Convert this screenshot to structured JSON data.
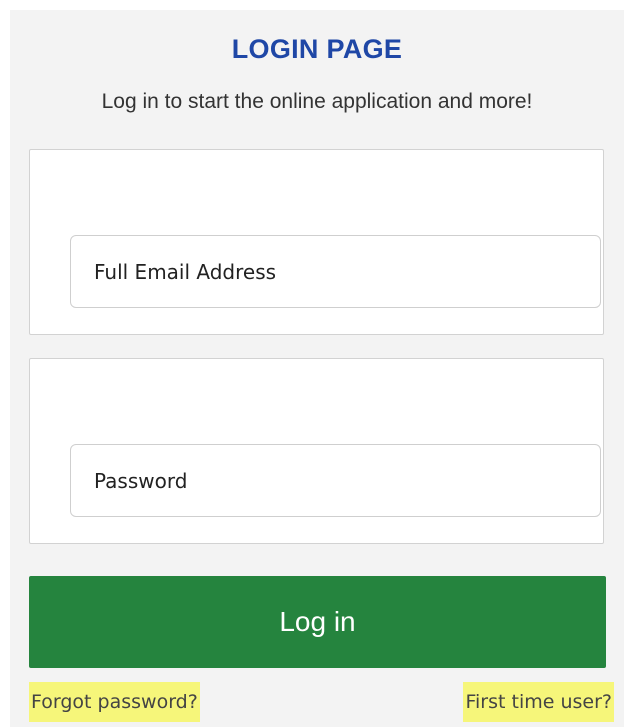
{
  "header": {
    "title": "LOGIN PAGE",
    "subtitle": "Log in to start the online application and more!"
  },
  "form": {
    "email_placeholder": "Full Email Address",
    "password_placeholder": "Password",
    "login_label": "Log in"
  },
  "links": {
    "forgot_password": "Forgot password?",
    "first_time_user": "First time user?"
  },
  "colors": {
    "title": "#1f47a6",
    "login_button": "#25843e",
    "link_highlight": "#f6f67a",
    "panel_background": "#f3f3f3"
  }
}
